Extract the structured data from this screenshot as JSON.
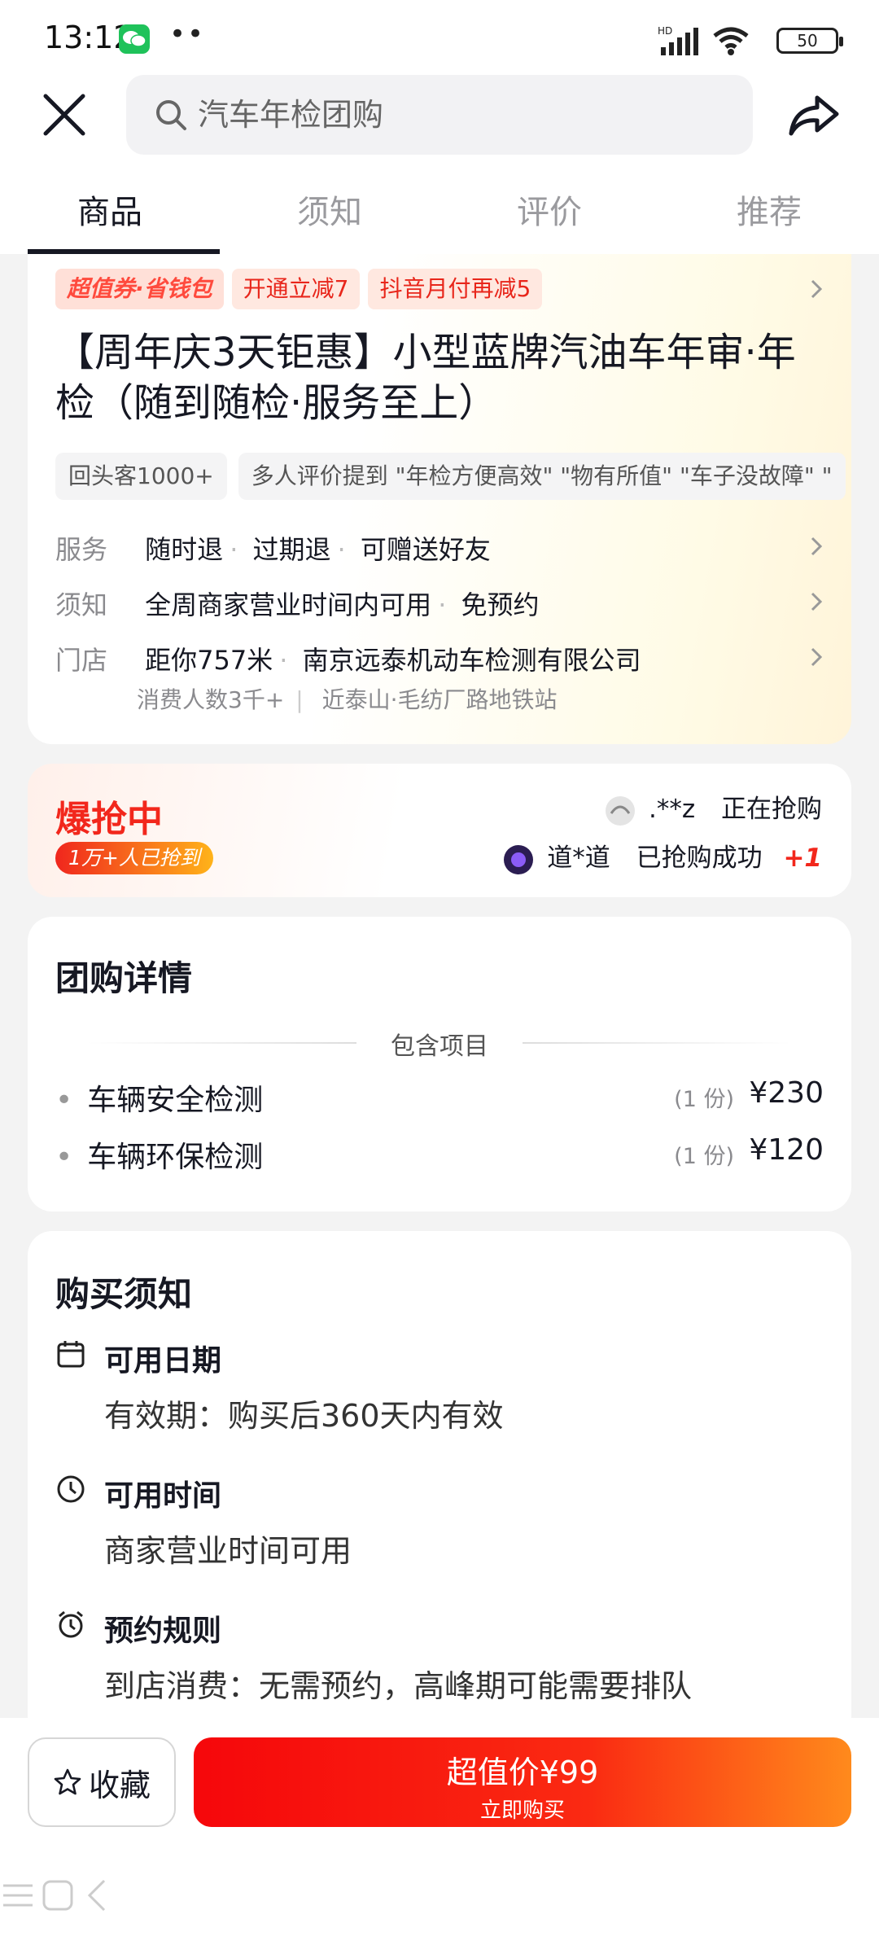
{
  "status_bar": {
    "time": "13:12",
    "network": "HD",
    "battery": "50"
  },
  "search": {
    "placeholder": "汽车年检团购"
  },
  "tabs": [
    {
      "label": "商品",
      "active": true
    },
    {
      "label": "须知",
      "active": false
    },
    {
      "label": "评价",
      "active": false
    },
    {
      "label": "推荐",
      "active": false
    }
  ],
  "product": {
    "promo_brand": "超值券·省钱包",
    "promo_open": "开通立减7",
    "promo_monthly": "抖音月付再减5",
    "title": "【周年庆3天钜惠】小型蓝牌汽油车年审·年检（随到随检·服务至上）",
    "returning": "回头客1000+",
    "review_summary": "多人评价提到 \"年检方便高效\" \"物有所值\" \"车子没故障\" \"",
    "service": {
      "label": "服务",
      "items": [
        "随时退",
        "过期退",
        "可赠送好友"
      ]
    },
    "notice": {
      "label": "须知",
      "items": [
        "全周商家营业时间内可用",
        "免预约"
      ]
    },
    "store": {
      "label": "门店",
      "distance": "距你757米",
      "name": "南京远泰机动车检测有限公司",
      "visitors": "消费人数3千+",
      "location": "近泰山·毛纺厂路地铁站"
    }
  },
  "rush": {
    "title": "爆抢中",
    "badge": "1万+人已抢到",
    "line1_user": ".**z",
    "line1_status": "正在抢购",
    "line2_user": "道*道",
    "line2_status": "已抢购成功",
    "line2_plus": "+1"
  },
  "group_detail": {
    "heading": "团购详情",
    "section_label": "包含项目",
    "items": [
      {
        "name": "车辆安全检测",
        "qty": "(1 份)",
        "price": "¥230"
      },
      {
        "name": "车辆环保检测",
        "qty": "(1 份)",
        "price": "¥120"
      }
    ]
  },
  "purchase_notice": {
    "heading": "购买须知",
    "sections": [
      {
        "icon": "calendar-icon",
        "title": "可用日期",
        "body": "有效期：购买后360天内有效"
      },
      {
        "icon": "clock-icon",
        "title": "可用时间",
        "body": "商家营业时间可用"
      },
      {
        "icon": "alarm-icon",
        "title": "预约规则",
        "body": "到店消费：无需预约，高峰期可能需要排队"
      }
    ]
  },
  "bottom": {
    "favorite_label": "收藏",
    "buy_main": "超值价¥99",
    "buy_sub": "立即购买"
  },
  "colors": {
    "accent_red": "#f2271c",
    "buy_gradient_start": "#f6070b",
    "buy_gradient_end": "#ff8a1c"
  }
}
